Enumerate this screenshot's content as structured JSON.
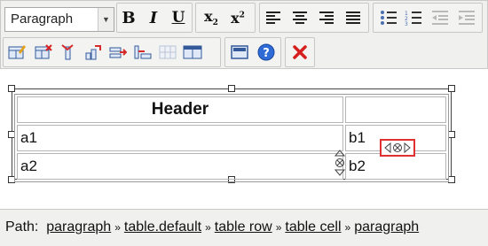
{
  "toolbar": {
    "format_select": {
      "value": "Paragraph",
      "arrow": "▼"
    },
    "bold_label": "B",
    "italic_label": "I",
    "underline_label": "U",
    "subscript_label": "x",
    "subscript_sub": "2",
    "superscript_label": "x",
    "superscript_sup": "2"
  },
  "table": {
    "header": "Header",
    "rows": [
      {
        "a": "a1",
        "b": "b1"
      },
      {
        "a": "a2",
        "b": "b2"
      }
    ]
  },
  "status_bar": {
    "label": "Path:",
    "separator": "»",
    "path": [
      "paragraph",
      "table.default",
      "table row",
      "table cell",
      "paragraph"
    ]
  },
  "colors": {
    "toolbar_bg": "#f0f0ee",
    "delete_icon": "#d62020",
    "help_icon": "#2f6bd6",
    "insert_icon": "#d42a2a"
  }
}
